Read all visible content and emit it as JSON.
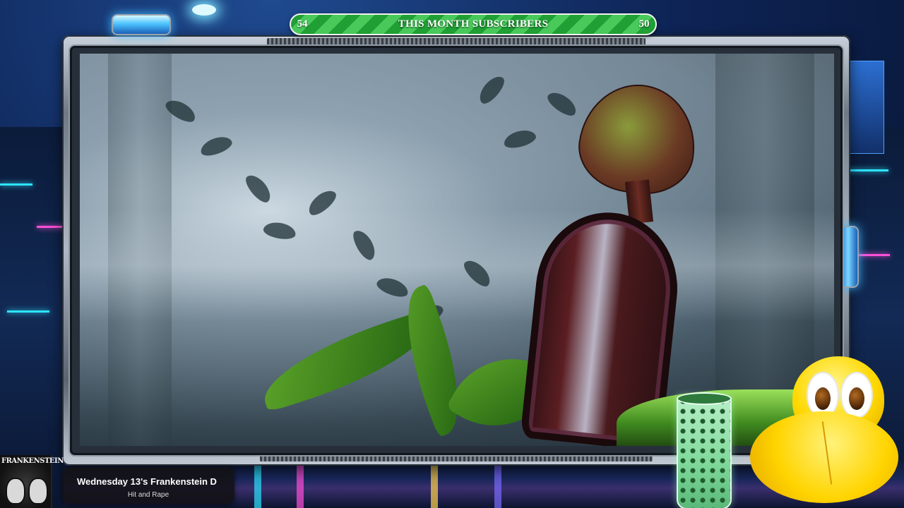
{
  "subscriber_goal": {
    "title": "THIS MONTH SUBSCRIBERS",
    "current": "54",
    "target": "50",
    "colors": {
      "stripe_dark": "#1f9f34",
      "stripe_light": "#48c95a"
    }
  },
  "now_playing": {
    "album_art_text": "FRANKENSTEIN",
    "track": "Wednesday 13's Frankenstein D",
    "artist": "Hit and Rape"
  },
  "scene": {
    "game_view": "game-viewport",
    "overlay_frame": "sci-fi-metal-frame"
  },
  "icons": {
    "cup": "clover-cup-icon",
    "mascot": "koopa-mascot-icon"
  }
}
